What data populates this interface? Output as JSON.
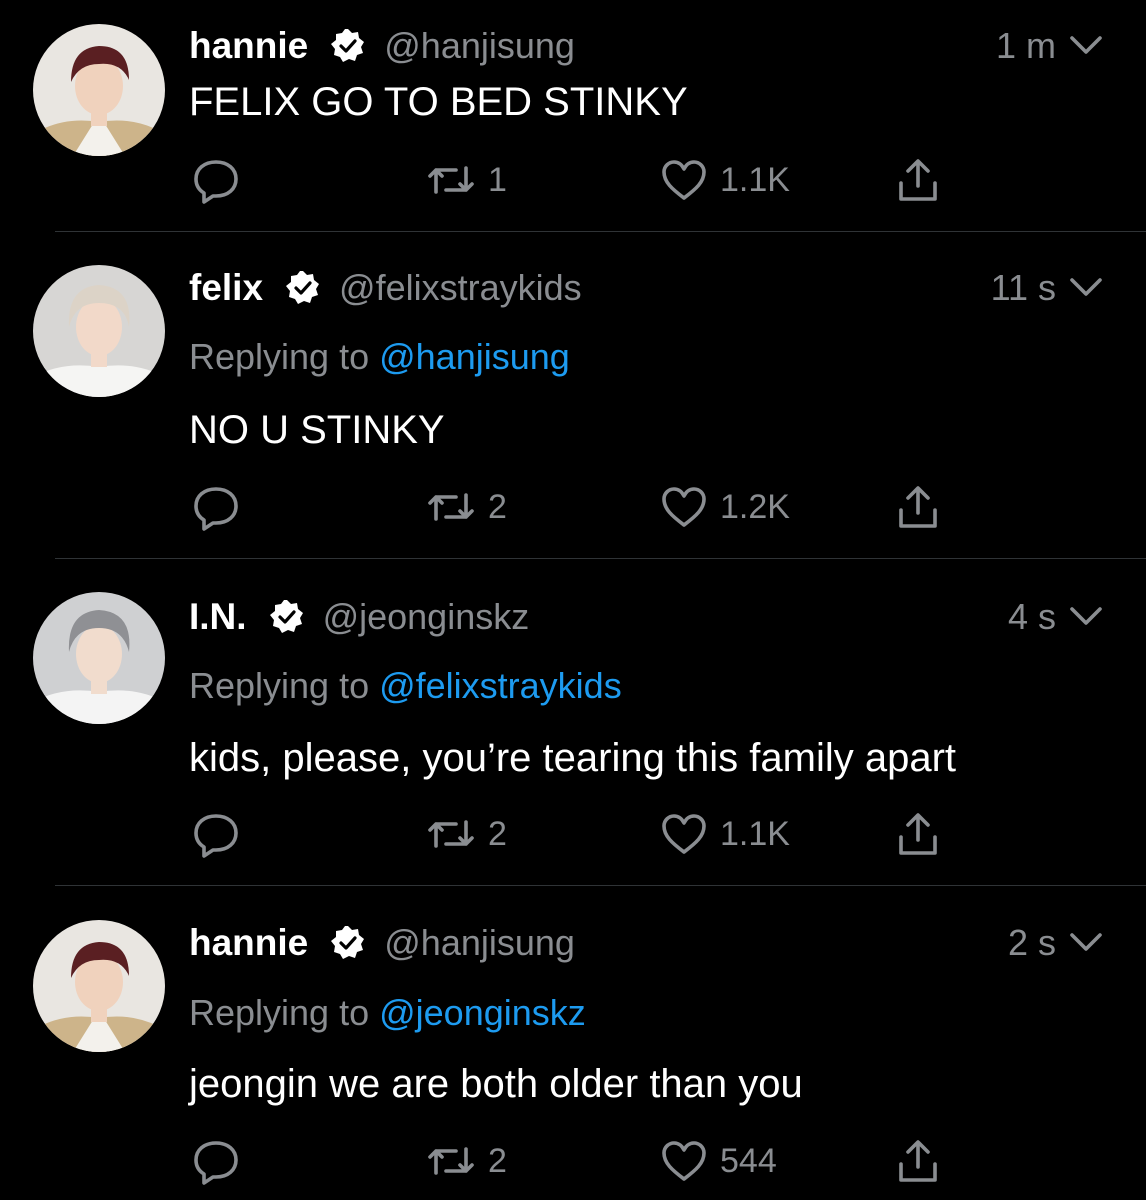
{
  "colors": {
    "background": "#000000",
    "text_primary": "#ffffff",
    "text_secondary": "#8a8d91",
    "mention": "#1d9bf0",
    "divider": "#2f3336"
  },
  "tweets": [
    {
      "name": "hannie",
      "handle": "@hanjisung",
      "time": "1 m",
      "replying_prefix": "",
      "replying_to": "",
      "text": "FELIX GO TO BED STINKY",
      "retweets": "1",
      "likes": "1.1K",
      "avatar_icon": "avatar-hannie"
    },
    {
      "name": "felix",
      "handle": "@felixstraykids",
      "time": "11 s",
      "replying_prefix": "Replying to ",
      "replying_to": "@hanjisung",
      "text": "NO U STINKY",
      "retweets": "2",
      "likes": "1.2K",
      "avatar_icon": "avatar-felix"
    },
    {
      "name": "I.N.",
      "handle": "@jeonginskz",
      "time": "4 s",
      "replying_prefix": "Replying to ",
      "replying_to": "@felixstraykids",
      "text": "kids, please, you’re tearing this family apart",
      "retweets": "2",
      "likes": "1.1K",
      "avatar_icon": "avatar-in"
    },
    {
      "name": "hannie",
      "handle": "@hanjisung",
      "time": "2 s",
      "replying_prefix": "Replying to ",
      "replying_to": "@jeonginskz",
      "text": "jeongin we are both older than you",
      "retweets": "2",
      "likes": "544",
      "avatar_icon": "avatar-hannie"
    }
  ],
  "icons": {
    "verified": "verified-badge-icon",
    "chevron": "chevron-down-icon",
    "reply": "reply-icon",
    "retweet": "retweet-icon",
    "like": "heart-icon",
    "share": "share-icon"
  }
}
